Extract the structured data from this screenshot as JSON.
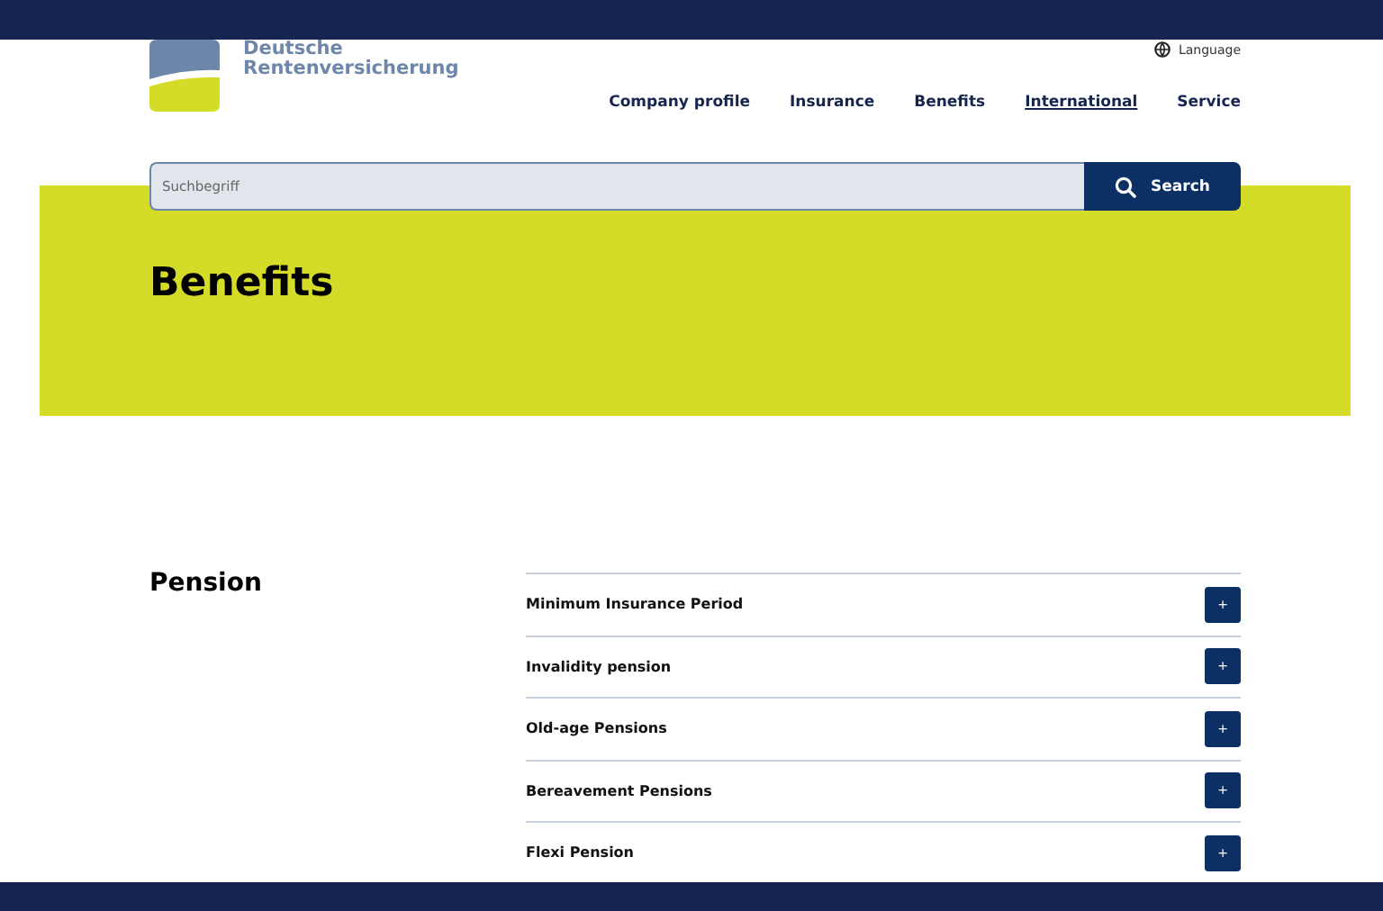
{
  "logo": {
    "line_1": "Deutsche",
    "line_2": "Rentenversicherung"
  },
  "language": "Language",
  "nav": [
    {
      "label": "Company profile",
      "selected": false
    },
    {
      "label": "Insurance",
      "selected": false
    },
    {
      "label": "Benefits",
      "selected": false
    },
    {
      "label": "International",
      "selected": true
    },
    {
      "label": "Service",
      "selected": false
    }
  ],
  "search": {
    "placeholder": "Suchbegriff",
    "button": "Search"
  },
  "page_title": "Benefits",
  "section": {
    "title": "Pension",
    "items": [
      {
        "label": "Minimum Insurance Period",
        "toggle": "+"
      },
      {
        "label": "Invalidity pension",
        "toggle": "+"
      },
      {
        "label": "Old-age Pensions",
        "toggle": "+"
      },
      {
        "label": "Bereavement Pensions",
        "toggle": "+"
      },
      {
        "label": "Flexi Pension",
        "toggle": "+"
      }
    ]
  }
}
